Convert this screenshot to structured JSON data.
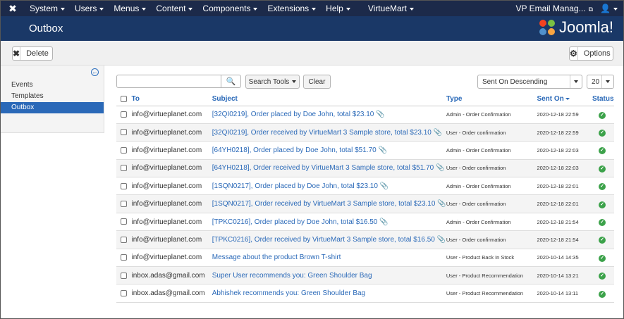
{
  "topnav": {
    "menus": [
      "System",
      "Users",
      "Menus",
      "Content",
      "Components",
      "Extensions",
      "Help"
    ],
    "virtuemart": "VirtueMart",
    "site_link": "VP Email Manag...",
    "user_icon": "user-icon"
  },
  "header": {
    "title": "Outbox",
    "brand": "Joomla!"
  },
  "toolbar": {
    "delete_label": "Delete",
    "options_label": "Options"
  },
  "sidebar": {
    "items": [
      {
        "label": "Events"
      },
      {
        "label": "Templates"
      },
      {
        "label": "Outbox"
      }
    ]
  },
  "filters": {
    "search_placeholder": "",
    "search_tools_label": "Search Tools",
    "clear_label": "Clear",
    "sort_value": "Sent On Descending",
    "limit_value": "20"
  },
  "table": {
    "headers": {
      "to": "To",
      "subject": "Subject",
      "type": "Type",
      "sent_on": "Sent On",
      "status": "Status"
    },
    "rows": [
      {
        "to": "info@virtueplanet.com",
        "subject": "[32QI0219], Order placed by Doe John, total $23.10",
        "attachment": true,
        "type": "Admin - Order Confirmation",
        "sent_on": "2020-12-18 22:59"
      },
      {
        "to": "info@virtueplanet.com",
        "subject": "[32QI0219], Order received by VirtueMart 3 Sample store, total $23.10",
        "attachment": true,
        "type": "User - Order confirmation",
        "sent_on": "2020-12-18 22:59"
      },
      {
        "to": "info@virtueplanet.com",
        "subject": "[64YH0218], Order placed by Doe John, total $51.70",
        "attachment": true,
        "type": "Admin - Order Confirmation",
        "sent_on": "2020-12-18 22:03"
      },
      {
        "to": "info@virtueplanet.com",
        "subject": "[64YH0218], Order received by VirtueMart 3 Sample store, total $51.70",
        "attachment": true,
        "type": "User - Order confirmation",
        "sent_on": "2020-12-18 22:03"
      },
      {
        "to": "info@virtueplanet.com",
        "subject": "[1SQN0217], Order placed by Doe John, total $23.10",
        "attachment": true,
        "type": "Admin - Order Confirmation",
        "sent_on": "2020-12-18 22:01"
      },
      {
        "to": "info@virtueplanet.com",
        "subject": "[1SQN0217], Order received by VirtueMart 3 Sample store, total $23.10",
        "attachment": true,
        "type": "User - Order confirmation",
        "sent_on": "2020-12-18 22:01"
      },
      {
        "to": "info@virtueplanet.com",
        "subject": "[TPKC0216], Order placed by Doe John, total $16.50",
        "attachment": true,
        "type": "Admin - Order Confirmation",
        "sent_on": "2020-12-18 21:54"
      },
      {
        "to": "info@virtueplanet.com",
        "subject": "[TPKC0216], Order received by VirtueMart 3 Sample store, total $16.50",
        "attachment": true,
        "type": "User - Order confirmation",
        "sent_on": "2020-12-18 21:54"
      },
      {
        "to": "info@virtueplanet.com",
        "subject": "Message about the product Brown T-shirt",
        "attachment": false,
        "type": "User - Product Back In Stock",
        "sent_on": "2020-10-14 14:35"
      },
      {
        "to": "inbox.adas@gmail.com",
        "subject": "Super User recommends you: Green Shoulder Bag",
        "attachment": false,
        "type": "User - Product Recommendation",
        "sent_on": "2020-10-14 13:21"
      },
      {
        "to": "inbox.adas@gmail.com",
        "subject": "Abhishek recommends you: Green Shoulder Bag",
        "attachment": false,
        "type": "User - Product Recommendation",
        "sent_on": "2020-10-14 13:11"
      }
    ]
  },
  "colors": {
    "nav": "#1c2a4a",
    "header": "#1a3867",
    "link": "#2a69b8",
    "status_ok": "#3ca24a",
    "active": "#2a69b8"
  }
}
